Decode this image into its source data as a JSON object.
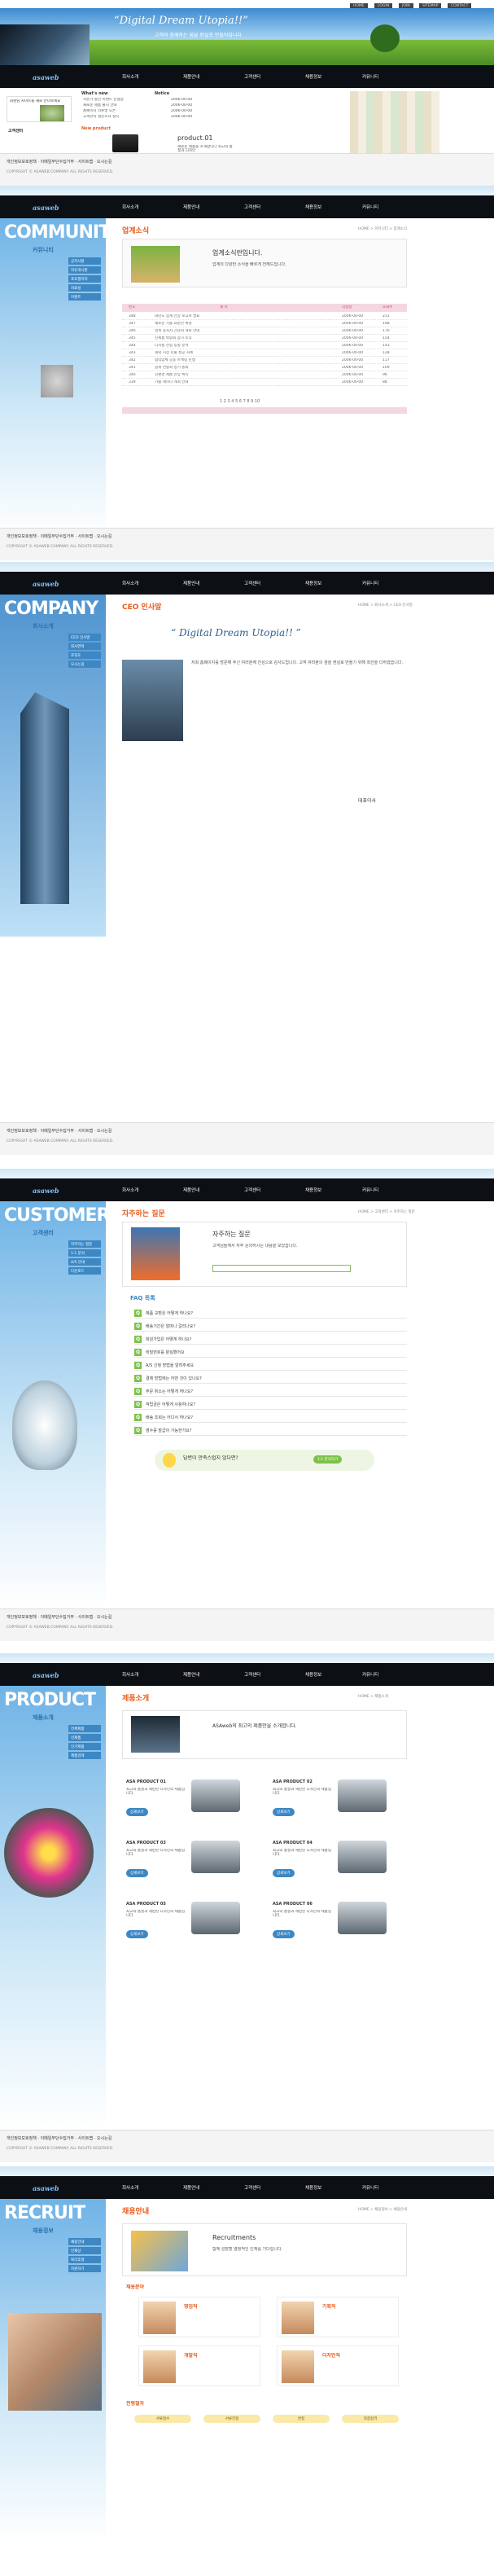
{
  "brand": {
    "logo": "asa",
    "logo_sub": "web"
  },
  "util_links": [
    "HOME",
    "LOGIN",
    "JOIN",
    "SITEMAP",
    "CONTACT"
  ],
  "nav": [
    "회사소개",
    "제품안내",
    "고객센터",
    "채용정보",
    "커뮤니티"
  ],
  "footer": {
    "line1": "개인정보보호정책 · 이메일무단수집거부 · 사이트맵 · 오시는길",
    "line2": "COPYRIGHT © ASAWEB COMPANY. ALL RIGHTS RESERVED.",
    "family_site": "Family Site"
  },
  "home": {
    "headline": "“Digital Dream Utopia!!”",
    "subline": "고객과 함께하는 꿈을 현실로 만들어갑니다",
    "news_title": "회원님 사이트를 새로 만나보세요",
    "whats_new": "What's new",
    "notice": "Notice",
    "new_product": "New product",
    "product_name": "product.01",
    "product_desc": "새로운 제품을 소개합니다 최고의 품질과 디자인",
    "customer": "고객센터",
    "news_items": [
      "시즌가 할인 이벤트 진행중",
      "새로운 제품 출시 안내",
      "홈페이지 리뉴얼 오픈",
      "고객만족 설문조사 실시"
    ],
    "notice_items": [
      "2006-00-00",
      "2006-00-00",
      "2006-00-00",
      "2006-00-00"
    ]
  },
  "community": {
    "side_title": "COMMUNITY",
    "side_sub": "커뮤니티",
    "menu": [
      "공지사항",
      "자유게시판",
      "포토갤러리",
      "자료실",
      "이벤트"
    ],
    "page_title": "업계소식",
    "breadcrumb": "HOME > 커뮤니티 > 업계소식",
    "intro_title": "업계소식란입니다.",
    "intro_desc": "업계의 다양한 소식을 빠르게 전해드립니다.",
    "board_head": [
      "번호",
      "제 목",
      "작성일",
      "조회수"
    ],
    "rows": [
      [
        "348",
        "내년도 업계 전망 보고서 발표",
        "2006-00-00",
        "231"
      ],
      [
        "347",
        "새로운 기술 표준안 확정",
        "2006-00-00",
        "198"
      ],
      [
        "346",
        "업계 종사자 간담회 개최 안내",
        "2006-00-00",
        "176"
      ],
      [
        "345",
        "신제품 박람회 참가 소식",
        "2006-00-00",
        "154"
      ],
      [
        "344",
        "디지털 산업 동향 분석",
        "2006-00-00",
        "143"
      ],
      [
        "343",
        "해외 시장 진출 성공 사례",
        "2006-00-00",
        "128"
      ],
      [
        "342",
        "협력업체 공동 마케팅 진행",
        "2006-00-00",
        "117"
      ],
      [
        "341",
        "업계 연합회 정기 총회",
        "2006-00-00",
        "109"
      ],
      [
        "340",
        "친환경 제품 인증 획득",
        "2006-00-00",
        "96"
      ],
      [
        "339",
        "기술 세미나 개최 안내",
        "2006-00-00",
        "88"
      ]
    ],
    "paging": "1 2 3 4 5 6 7 8 9 10",
    "search_btn": "검색"
  },
  "company": {
    "side_title": "COMPANY",
    "side_sub": "회사소개",
    "menu": [
      "CEO 인사말",
      "회사연혁",
      "조직도",
      "오시는길"
    ],
    "page_title": "CEO 인사말",
    "breadcrumb": "HOME > 회사소개 > CEO 인사말",
    "quote": "“ Digital Dream Utopia!! ”",
    "para": "저희 홈페이지를 방문해 주신 여러분께 진심으로 감사드립니다. 고객 여러분의 꿈을 현실로 만들기 위해 최선을 다하겠습니다.",
    "sign": "대표이사"
  },
  "customer": {
    "side_title": "CUSTOMER",
    "side_sub": "고객센터",
    "menu": [
      "자주하는 질문",
      "1:1 문의",
      "A/S 안내",
      "다운로드"
    ],
    "page_title": "자주하는 질문",
    "breadcrumb": "HOME > 고객센터 > 자주하는 질문",
    "intro_title": "자주하는 질문",
    "intro_desc": "고객님들께서 자주 문의하시는 내용을 모았습니다.",
    "faq_label": "FAQ 목록",
    "faqs": [
      "제품 교환은 어떻게 하나요?",
      "배송기간은 얼마나 걸리나요?",
      "회원가입은 어떻게 하나요?",
      "비밀번호를 분실했어요",
      "A/S 신청 방법을 알려주세요",
      "결제 방법에는 어떤 것이 있나요?",
      "주문 취소는 어떻게 하나요?",
      "적립금은 어떻게 사용하나요?",
      "배송 조회는 어디서 하나요?",
      "영수증 발급이 가능한가요?"
    ],
    "help_title": "답변이 만족스럽지 않다면?",
    "help_btn": "1:1 문의하기"
  },
  "product": {
    "side_title": "PRODUCT",
    "side_sub": "제품소개",
    "menu": [
      "전체제품",
      "신제품",
      "인기제품",
      "제품검색"
    ],
    "page_title": "제품소개",
    "breadcrumb": "HOME > 제품소개",
    "intro_title": "ASAweb의 최고의 제품만을 소개합니다.",
    "items": [
      "ASA PRODUCT 01",
      "ASA PRODUCT 02",
      "ASA PRODUCT 03",
      "ASA PRODUCT 04",
      "ASA PRODUCT 05",
      "ASA PRODUCT 06"
    ],
    "item_desc": "최고의 품질과 세련된 디자인의 제품입니다.",
    "more_btn": "상세보기"
  },
  "recruit": {
    "side_title": "RECRUIT",
    "side_sub": "채용정보",
    "menu": [
      "채용안내",
      "인재상",
      "복리후생",
      "지원하기"
    ],
    "page_title": "채용안내",
    "breadcrumb": "HOME > 채용정보 > 채용안내",
    "intro_title": "Recruitments",
    "intro_desc": "함께 성장할 열정적인 인재를 기다립니다.",
    "sec_label": "채용분야",
    "cards": [
      "영업직",
      "기획직",
      "개발직",
      "디자인직"
    ],
    "process_label": "전형절차",
    "steps": [
      "서류접수",
      "서류전형",
      "면접",
      "최종합격"
    ]
  },
  "colors": {
    "accent": "#e85a1b",
    "blue": "#3d88c4",
    "dark": "#0c0f14"
  }
}
